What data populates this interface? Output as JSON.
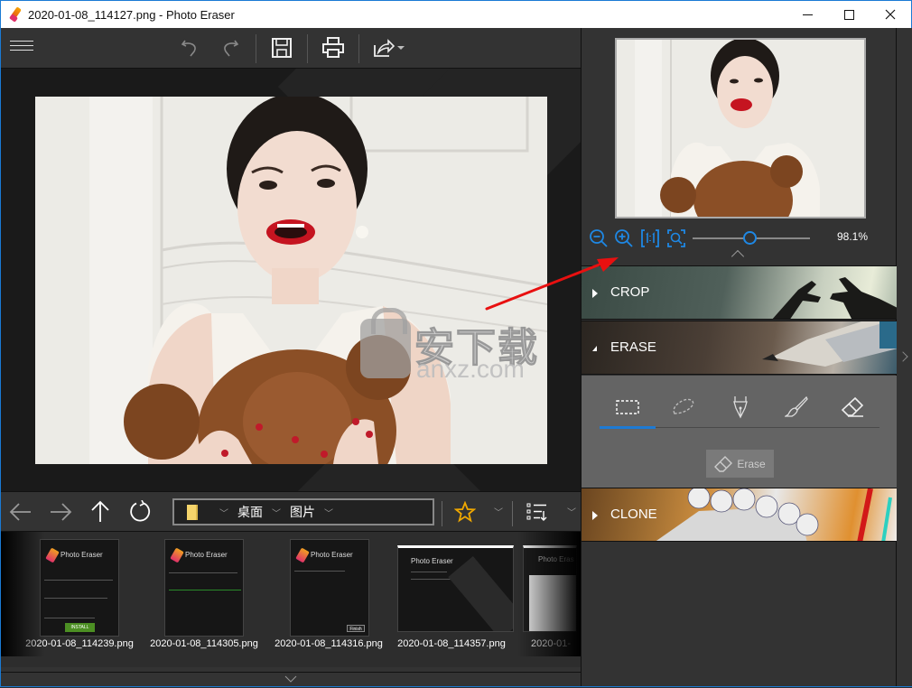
{
  "window": {
    "title": "2020-01-08_114127.png - Photo Eraser",
    "controls": [
      "minimize",
      "maximize",
      "close"
    ]
  },
  "toolbar": {
    "menu_icon": "hamburger-menu-icon",
    "buttons": [
      {
        "name": "undo",
        "icon": "undo-icon"
      },
      {
        "name": "redo",
        "icon": "redo-icon"
      },
      {
        "name": "save",
        "icon": "save-icon"
      },
      {
        "name": "print",
        "icon": "print-icon"
      },
      {
        "name": "share",
        "icon": "share-icon"
      }
    ]
  },
  "canvas": {
    "image_file": "2020-01-08_114127.png",
    "watermark_cn": "安下载",
    "watermark_en": "anxz.com"
  },
  "browser": {
    "nav": [
      "back",
      "forward",
      "up",
      "refresh"
    ],
    "path": [
      {
        "label": "",
        "icon": "folder-icon"
      },
      {
        "label": "桌面"
      },
      {
        "label": "图片"
      }
    ],
    "favorite_icon": "star-icon",
    "sort_icon": "sort-list-icon"
  },
  "thumbnails": [
    {
      "caption": "2020-01-08_114239.png",
      "mini_title": "Photo Eraser",
      "mini_button": "INSTALL"
    },
    {
      "caption": "2020-01-08_114305.png",
      "mini_title": "Photo Eraser"
    },
    {
      "caption": "2020-01-08_114316.png",
      "mini_title": "Photo Eraser",
      "mini_button": "Finish"
    },
    {
      "caption": "2020-01-08_114357.png",
      "mini_title": "Photo Eraser"
    },
    {
      "caption": "2020-01-",
      "mini_title": "Photo Eras"
    }
  ],
  "zoom": {
    "percent_label": "98.1%",
    "slider_fraction": 0.49,
    "buttons": [
      "zoom-out",
      "zoom-in",
      "actual-size",
      "fit-to-window"
    ]
  },
  "sections": {
    "crop": {
      "label": "CROP",
      "expanded": false
    },
    "erase": {
      "label": "ERASE",
      "expanded": true
    },
    "clone": {
      "label": "CLONE",
      "expanded": false
    }
  },
  "erase_tools": {
    "tools": [
      "rectangle-select",
      "lasso-select",
      "pen",
      "brush",
      "eraser"
    ],
    "active_index": 0,
    "erase_button": "Erase"
  },
  "colors": {
    "accent": "#1e7ad4",
    "panel_bg": "#333333",
    "erase_body": "#646464",
    "annotation_arrow": "#e81010",
    "star": "#f0a800"
  }
}
